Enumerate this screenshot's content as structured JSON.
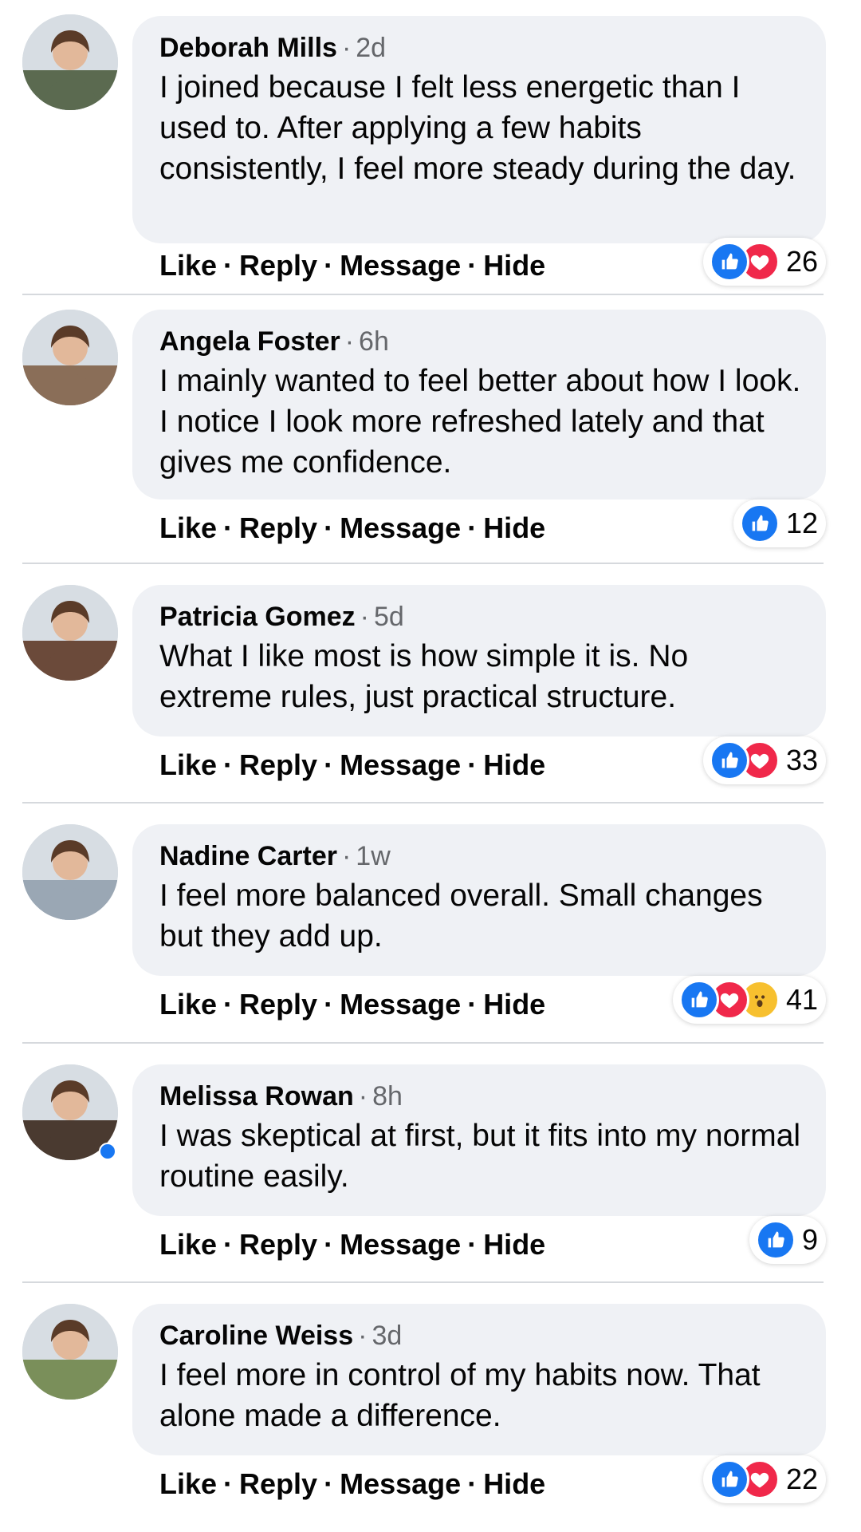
{
  "comments": [
    {
      "name": "Deborah Mills",
      "time": "2d",
      "text": "I joined because I felt less energetic than I used to. After applying a few habits consistently, I feel more steady during the day.",
      "actions": [
        "Like",
        "Reply",
        "Message",
        "Hide"
      ],
      "reaction_types": [
        "like",
        "love"
      ],
      "reaction_count": "26",
      "avatar_color": "#5b6a50"
    },
    {
      "name": "Angela Foster",
      "time": "6h",
      "text": "I mainly wanted to feel better about how I look. I notice I look more refreshed lately and that gives me confidence.",
      "actions": [
        "Like",
        "Reply",
        "Message",
        "Hide"
      ],
      "reaction_types": [
        "like"
      ],
      "reaction_count": "12",
      "avatar_color": "#8a6e58"
    },
    {
      "name": "Patricia Gomez",
      "time": "5d",
      "text": "What I like most is how simple it is. No extreme rules, just practical structure.",
      "actions": [
        "Like",
        "Reply",
        "Message",
        "Hide"
      ],
      "reaction_types": [
        "like",
        "love"
      ],
      "reaction_count": "33",
      "avatar_color": "#6b4a3a"
    },
    {
      "name": "Nadine Carter",
      "time": "1w",
      "text": "I feel more balanced overall. Small changes but they add up.",
      "actions": [
        "Like",
        "Reply",
        "Message",
        "Hide"
      ],
      "reaction_types": [
        "like",
        "love",
        "wow"
      ],
      "reaction_count": "41",
      "avatar_color": "#9aa7b4"
    },
    {
      "name": "Melissa Rowan",
      "time": "8h",
      "text": "I was skeptical at first, but it fits into my normal routine easily.",
      "actions": [
        "Like",
        "Reply",
        "Message",
        "Hide"
      ],
      "reaction_types": [
        "like"
      ],
      "reaction_count": "9",
      "avatar_color": "#4a3a30",
      "verified": true
    },
    {
      "name": "Caroline Weiss",
      "time": "3d",
      "text": "I feel more in control of my habits now. That alone made a difference.",
      "actions": [
        "Like",
        "Reply",
        "Message",
        "Hide"
      ],
      "reaction_types": [
        "like",
        "love"
      ],
      "reaction_count": "22",
      "avatar_color": "#7a8f5a"
    }
  ],
  "colors": {
    "bubble": "#eff1f5",
    "like": "#1877f2",
    "love": "#f0284a",
    "wow": "#f7c02f",
    "meta_text": "#65676b"
  }
}
